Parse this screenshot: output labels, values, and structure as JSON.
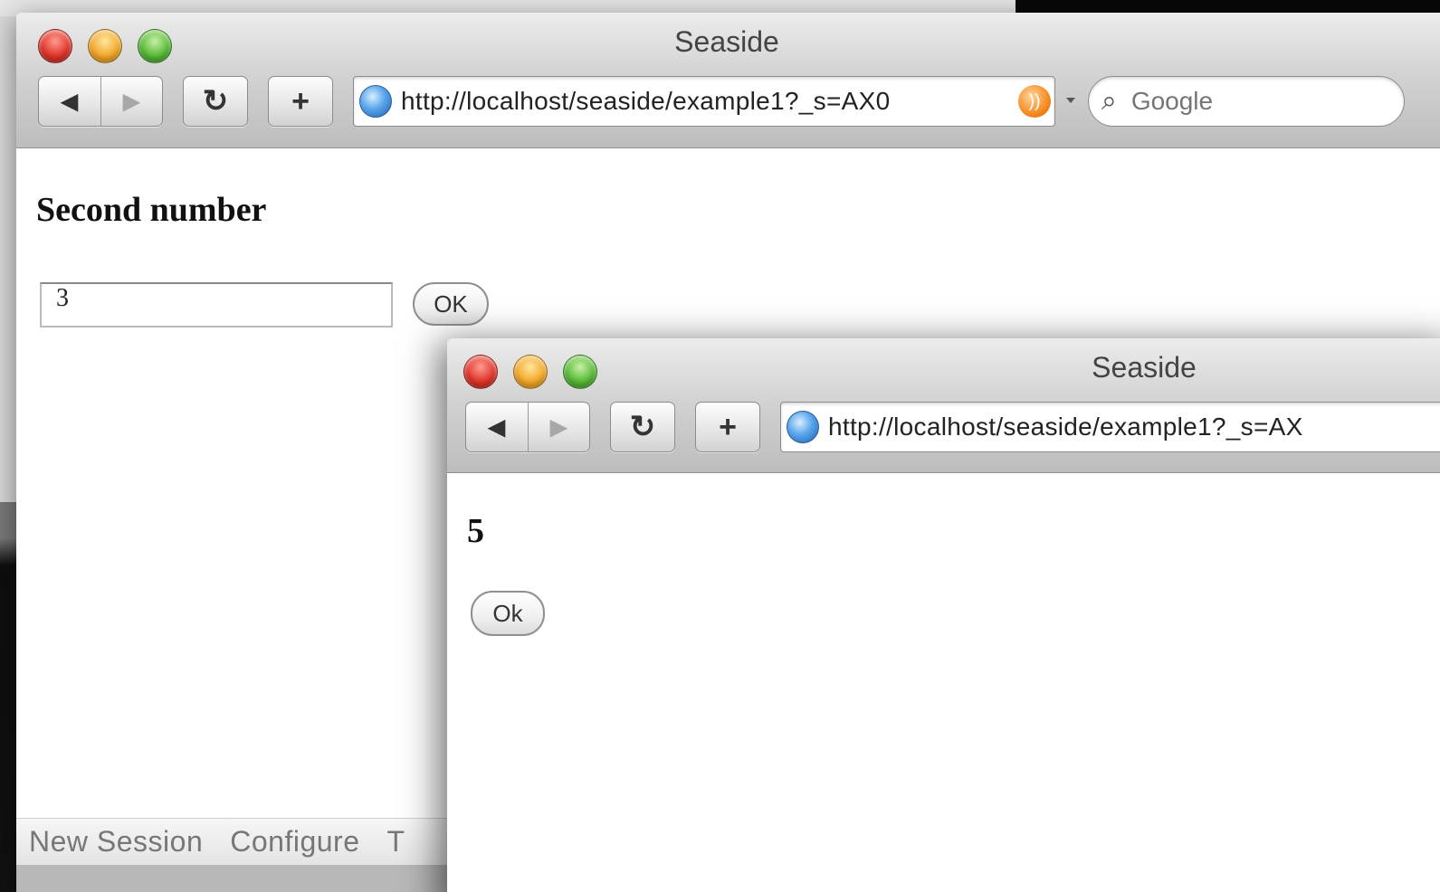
{
  "back_window": {
    "title": "Seaside",
    "url": "http://localhost/seaside/example1?_s=AX0",
    "search_placeholder": "Google",
    "page": {
      "heading": "Second number",
      "input_value": "3",
      "ok_label": "OK"
    },
    "footer": [
      "New Session",
      "Configure",
      "T"
    ]
  },
  "front_window": {
    "title": "Seaside",
    "url": "http://localhost/seaside/example1?_s=AX",
    "page": {
      "result": "5",
      "ok_label": "Ok"
    }
  },
  "icons": {
    "back": "◀",
    "forward": "▶",
    "reload": "↻",
    "add": "+",
    "search": "🔍"
  },
  "colors": {
    "close": "#e0362a",
    "minimize": "#f2a92a",
    "zoom": "#58bb36"
  }
}
